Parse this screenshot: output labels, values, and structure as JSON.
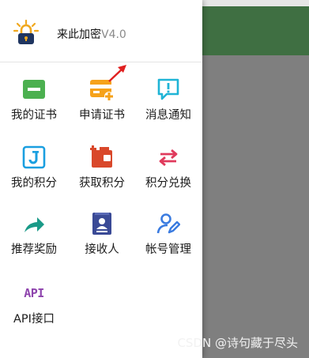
{
  "app": {
    "name": "来此加密",
    "version": "V4.0"
  },
  "menu": [
    {
      "label": "我的证书",
      "icon": "card-green-icon"
    },
    {
      "label": "申请证书",
      "icon": "card-add-icon"
    },
    {
      "label": "消息通知",
      "icon": "message-alert-icon"
    },
    {
      "label": "我的积分",
      "icon": "points-j-icon"
    },
    {
      "label": "获取积分",
      "icon": "wallet-add-icon"
    },
    {
      "label": "积分兑换",
      "icon": "exchange-arrows-icon"
    },
    {
      "label": "推荐奖励",
      "icon": "share-arrow-icon"
    },
    {
      "label": "接收人",
      "icon": "contact-card-icon"
    },
    {
      "label": "帐号管理",
      "icon": "user-edit-icon"
    },
    {
      "label": "API接口",
      "icon": "api-text-icon",
      "icon_text": "API"
    }
  ],
  "watermark": "CSDN @诗句藏于尽头",
  "colors": {
    "green_header": "#3f6f42",
    "accent_cyan": "#1fb4d6"
  }
}
